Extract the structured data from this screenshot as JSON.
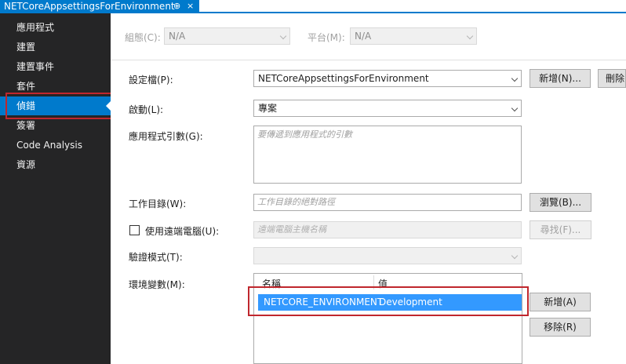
{
  "tab": {
    "title": "NETCoreAppsettingsForEnvironment",
    "pin": "⊕",
    "close": "×"
  },
  "sidebar": {
    "items": [
      {
        "label": "應用程式"
      },
      {
        "label": "建置"
      },
      {
        "label": "建置事件"
      },
      {
        "label": "套件"
      },
      {
        "label": "偵錯"
      },
      {
        "label": "簽署"
      },
      {
        "label": "Code Analysis"
      },
      {
        "label": "資源"
      }
    ],
    "selected": "偵錯"
  },
  "config": {
    "configuration_label": "組態(C):",
    "configuration_value": "N/A",
    "platform_label": "平台(M):",
    "platform_value": "N/A"
  },
  "form": {
    "profile_label": "設定檔(P):",
    "profile_value": "NETCoreAppsettingsForEnvironment",
    "new_button": "新增(N)...",
    "delete_button": "刪除",
    "launch_label": "啟動(L):",
    "launch_value": "專案",
    "args_label": "應用程式引數(G):",
    "args_placeholder": "要傳遞到應用程式的引數",
    "workdir_label": "工作目錄(W):",
    "workdir_placeholder": "工作目錄的絕對路徑",
    "browse_button": "瀏覽(B)...",
    "remote_label": "使用遠端電腦(U):",
    "remote_placeholder": "遠端電腦主機名稱",
    "find_button": "尋找(F)...",
    "auth_label": "驗證模式(T):",
    "auth_value": "",
    "env_label": "環境變數(M):",
    "env_headers": {
      "name": "名稱",
      "value": "值"
    },
    "env_rows": [
      {
        "name": "NETCORE_ENVIRONMENT",
        "value": "Development"
      }
    ],
    "add_button": "新增(A)",
    "remove_button": "移除(R)"
  },
  "colors": {
    "accent": "#007acc",
    "sidebar_bg": "#252526",
    "highlight": "#c0272d",
    "row_selected": "#3399ff"
  }
}
